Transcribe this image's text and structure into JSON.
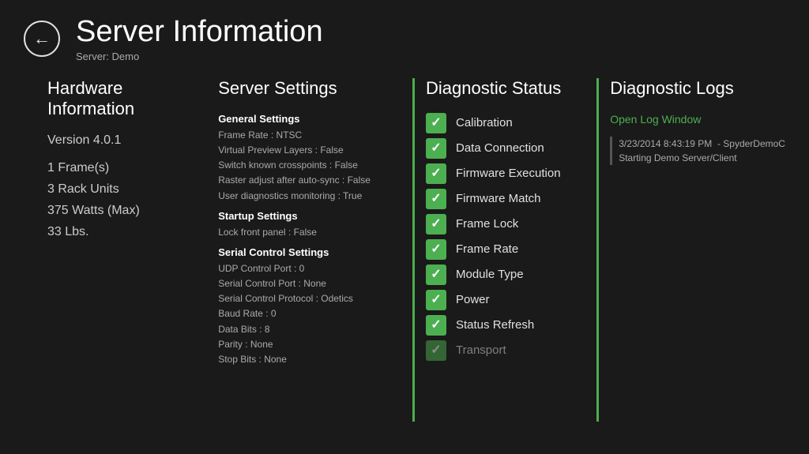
{
  "header": {
    "title": "Server Information",
    "subtitle": "Server: Demo",
    "back_icon": "←"
  },
  "hardware": {
    "section_title": "Hardware Information",
    "version": "Version 4.0.1",
    "items": [
      "1 Frame(s)",
      "3 Rack Units",
      "375 Watts (Max)",
      "33 Lbs."
    ]
  },
  "server_settings": {
    "section_title": "Server Settings",
    "groups": [
      {
        "title": "General Settings",
        "items": [
          "Frame Rate :  NTSC",
          "Virtual Preview Layers :  False",
          "Switch known crosspoints :  False",
          "Raster adjust after auto-sync :  False",
          "User diagnostics monitoring :  True"
        ]
      },
      {
        "title": "Startup Settings",
        "items": [
          "Lock front panel :  False"
        ]
      },
      {
        "title": "Serial Control Settings",
        "items": [
          "UDP Control Port :  0",
          "Serial Control Port :  None",
          "Serial Control Protocol :  Odetics",
          "Baud Rate :  0",
          "Data Bits :  8",
          "Parity :  None",
          "Stop Bits :  None"
        ]
      }
    ]
  },
  "diagnostic_status": {
    "section_title": "Diagnostic Status",
    "items": [
      {
        "label": "Calibration",
        "status": true
      },
      {
        "label": "Data Connection",
        "status": true
      },
      {
        "label": "Firmware Execution",
        "status": true
      },
      {
        "label": "Firmware Match",
        "status": true
      },
      {
        "label": "Frame Lock",
        "status": true
      },
      {
        "label": "Frame Rate",
        "status": true
      },
      {
        "label": "Module Type",
        "status": true
      },
      {
        "label": "Power",
        "status": true
      },
      {
        "label": "Status Refresh",
        "status": true
      },
      {
        "label": "Transport",
        "status": true
      }
    ]
  },
  "diagnostic_logs": {
    "section_title": "Diagnostic Logs",
    "open_log_label": "Open Log Window",
    "log_entries": [
      {
        "timestamp": "3/23/2014 8:43:19 PM  - SpyderDemoC",
        "message": "Starting Demo Server/Client"
      }
    ]
  },
  "colors": {
    "green": "#4caf50",
    "bg": "#1a1a1a",
    "text_primary": "#ffffff",
    "text_secondary": "#aaaaaa"
  }
}
